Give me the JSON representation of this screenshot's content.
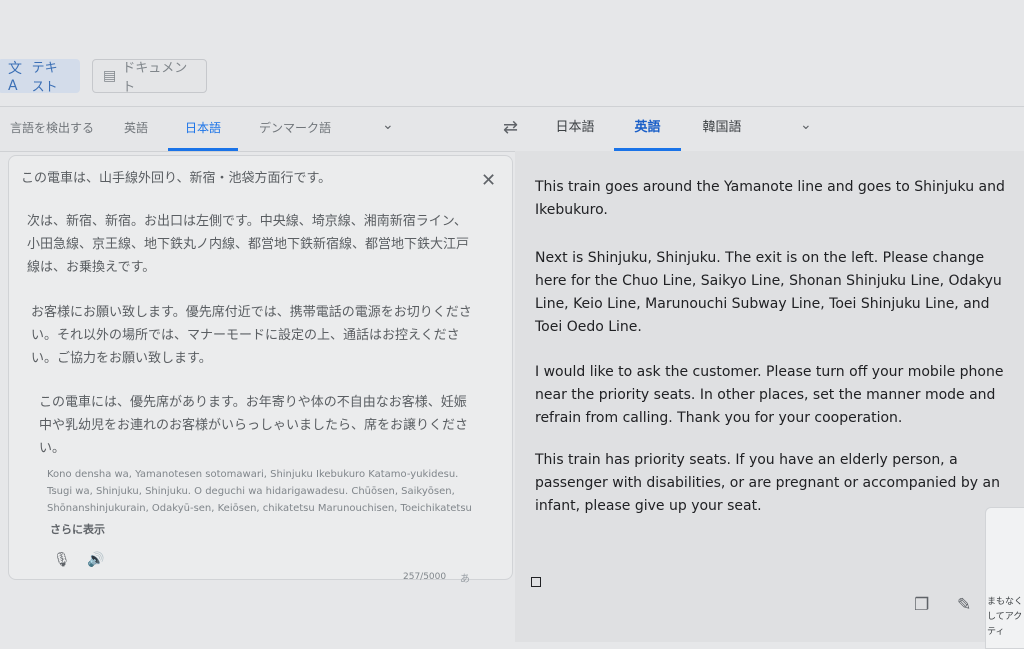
{
  "mode_tabs": {
    "text": "テキスト",
    "document": "ドキュメント"
  },
  "source_langs": [
    "言語を検出する",
    "英語",
    "日本語",
    "デンマーク語"
  ],
  "target_langs": [
    "日本語",
    "英語",
    "韓国語"
  ],
  "source_text": {
    "p1": "この電車は、山手線外回り、新宿・池袋方面行です。",
    "p2": "次は、新宿、新宿。お出口は左側です。中央線、埼京線、湘南新宿ライン、小田急線、京王線、地下鉄丸ノ内線、都営地下鉄新宿線、都営地下鉄大江戸線は、お乗換えです。",
    "p3": "お客様にお願い致します。優先席付近では、携帯電話の電源をお切りください。それ以外の場所では、マナーモードに設定の上、通話はお控えください。ご協力をお願い致します。",
    "p4": "この電車には、優先席があります。お年寄りや体の不自由なお客様、妊娠中や乳幼児をお連れのお客様がいらっしゃいましたら、席をお譲りください。"
  },
  "romanization": "Kono densha wa, Yamanotesen sotomawari, Shinjuku Ikebukuro Katamo-yukidesu. Tsugi wa, Shinjuku, Shinjuku. O deguchi wa hidarigawadesu. Chūōsen, Saikyōsen, Shōnanshinjukurain, Odakyū-sen, Keiōsen, chikatetsu Marunouchisen, Toeichikatetsu",
  "show_more": "さらに表示",
  "char_count": "257/5000",
  "ime_label": "あ",
  "translation": {
    "p1": "This train goes around the Yamanote line and goes to Shinjuku and Ikebukuro.",
    "p2": "Next is Shinjuku, Shinjuku. The exit is on the left. Please change here for the Chuo Line, Saikyo Line, Shonan Shinjuku Line, Odakyu Line, Keio Line, Marunouchi Subway Line, Toei Shinjuku Line, and Toei Oedo Line.",
    "p3": "I would like to ask the customer. Please turn off your mobile phone near the priority seats. In other places, set the manner mode and refrain from calling. Thank you for your cooperation.",
    "p4": "This train has priority seats. If you have an elderly person, a passenger with disabilities, or are pregnant or accompanied by an infant, please give up your seat."
  },
  "popup_text": "まもなくしてアクティ",
  "icons": {
    "text_mode": "translate-icon",
    "document_mode": "document-icon",
    "swap": "swap-languages-icon",
    "clear": "close-icon",
    "mic": "microphone-icon",
    "speaker": "speaker-icon",
    "copy": "copy-icon",
    "edit": "pencil-icon"
  },
  "colors": {
    "accent": "#1a73e8"
  }
}
